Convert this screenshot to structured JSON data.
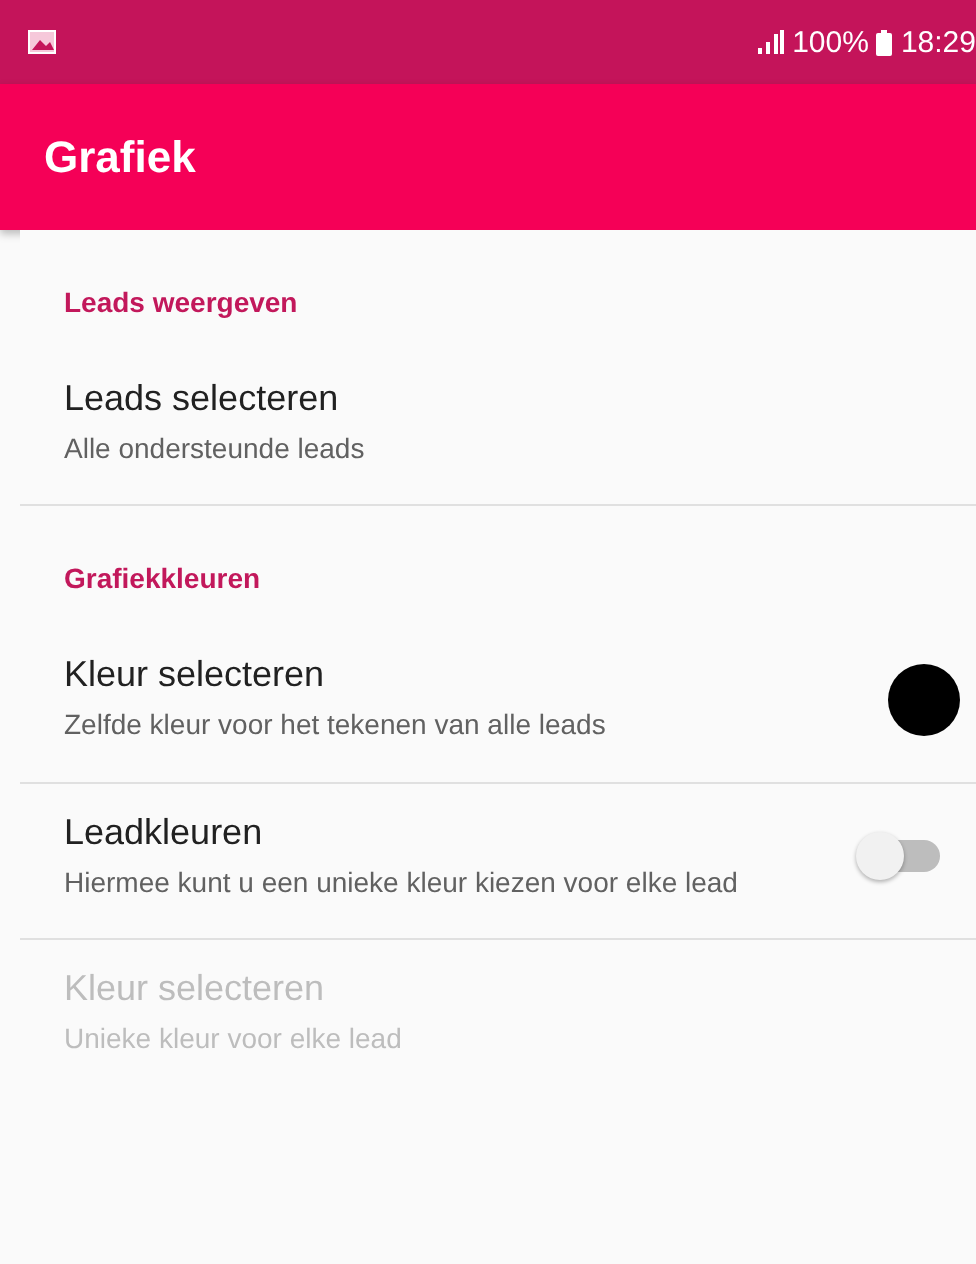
{
  "status_bar": {
    "battery": "100%",
    "time": "18:29"
  },
  "app_bar": {
    "title": "Grafiek"
  },
  "sections": [
    {
      "header": "Leads weergeven",
      "items": [
        {
          "kind": "plain",
          "title": "Leads selecteren",
          "summary": "Alle ondersteunde leads",
          "disabled": false
        }
      ]
    },
    {
      "header": "Grafiekkleuren",
      "items": [
        {
          "kind": "color",
          "title": "Kleur selecteren",
          "summary": "Zelfde kleur voor het tekenen van alle leads",
          "color": "#000000",
          "disabled": false
        },
        {
          "kind": "switch",
          "title": "Leadkleuren",
          "summary": "Hiermee kunt u een unieke kleur kiezen voor elke lead",
          "on": false,
          "disabled": false
        },
        {
          "kind": "plain",
          "title": "Kleur selecteren",
          "summary": "Unieke kleur voor elke lead",
          "disabled": true
        }
      ]
    }
  ]
}
